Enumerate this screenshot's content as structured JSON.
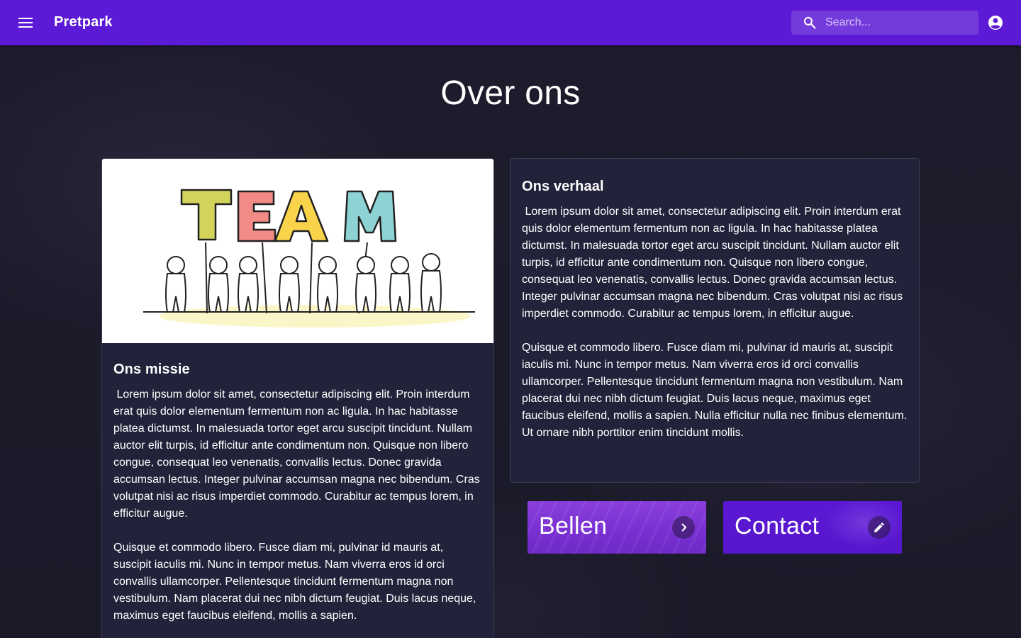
{
  "header": {
    "brand": "Pretpark",
    "search_placeholder": "Search...",
    "menu_icon": "menu-icon",
    "account_icon": "account-circle-icon",
    "color": "#5c19d6"
  },
  "page": {
    "title": "Over ons"
  },
  "mission_card": {
    "image_text": "TEAM",
    "title": "Ons missie",
    "paragraph1": " Lorem ipsum dolor sit amet, consectetur adipiscing elit. Proin interdum erat quis dolor elementum fermentum non ac ligula. In hac habitasse platea dictumst. In malesuada tortor eget arcu suscipit tincidunt. Nullam auctor elit turpis, id efficitur ante condimentum non. Quisque non libero congue, consequat leo venenatis, convallis lectus. Donec gravida accumsan lectus. Integer pulvinar accumsan magna nec bibendum. Cras volutpat nisi ac risus imperdiet commodo. Curabitur ac tempus lorem, in efficitur augue.",
    "paragraph2": "Quisque et commodo libero. Fusce diam mi, pulvinar id mauris at, suscipit iaculis mi. Nunc in tempor metus. Nam viverra eros id orci convallis ullamcorper. Pellentesque tincidunt fermentum magna non vestibulum. Nam placerat dui nec nibh dictum feugiat. Duis lacus neque, maximus eget faucibus eleifend, mollis a sapien."
  },
  "story_card": {
    "title": "Ons verhaal",
    "paragraph1": " Lorem ipsum dolor sit amet, consectetur adipiscing elit. Proin interdum erat quis dolor elementum fermentum non ac ligula. In hac habitasse platea dictumst. In malesuada tortor eget arcu suscipit tincidunt. Nullam auctor elit turpis, id efficitur ante condimentum non. Quisque non libero congue, consequat leo venenatis, convallis lectus. Donec gravida accumsan lectus. Integer pulvinar accumsan magna nec bibendum. Cras volutpat nisi ac risus imperdiet commodo. Curabitur ac tempus lorem, in efficitur augue.",
    "paragraph2": "Quisque et commodo libero. Fusce diam mi, pulvinar id mauris at, suscipit iaculis mi. Nunc in tempor metus. Nam viverra eros id orci convallis ullamcorper. Pellentesque tincidunt fermentum magna non vestibulum. Nam placerat dui nec nibh dictum feugiat. Duis lacus neque, maximus eget faucibus eleifend, mollis a sapien. Nulla efficitur nulla nec finibus elementum. Ut ornare nibh porttitor enim tincidunt mollis."
  },
  "actions": [
    {
      "label": "Bellen",
      "icon": "chevron-right-icon"
    },
    {
      "label": "Contact",
      "icon": "pencil-icon"
    }
  ]
}
